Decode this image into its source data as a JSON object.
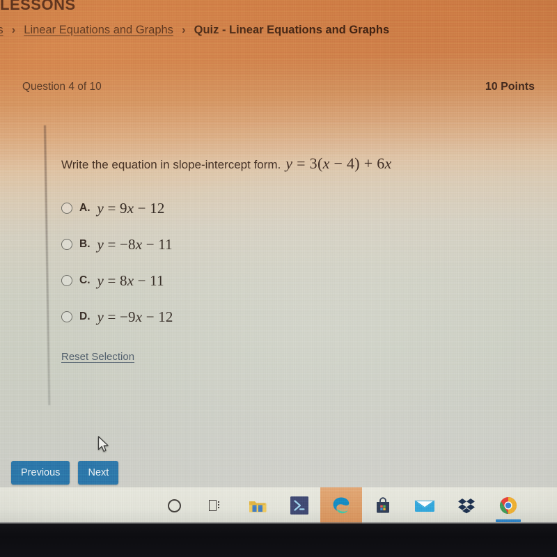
{
  "header": {
    "section_label": "LESSONS",
    "breadcrumb": [
      {
        "label": "ons",
        "type": "link"
      },
      {
        "label": "›",
        "type": "separator"
      },
      {
        "label": "Linear Equations and Graphs",
        "type": "link"
      },
      {
        "label": "›",
        "type": "separator"
      },
      {
        "label": "Quiz - Linear Equations and Graphs",
        "type": "current"
      }
    ]
  },
  "quiz": {
    "question_counter": "Question 4 of 10",
    "points": "10 Points",
    "prompt_text": "Write the equation in slope-intercept form.",
    "prompt_equation": "y = 3(x − 4) + 6x",
    "choices": [
      {
        "letter": "A.",
        "equation": "y = 9x − 12",
        "selected": false
      },
      {
        "letter": "B.",
        "equation": "y = −8x − 11",
        "selected": false
      },
      {
        "letter": "C.",
        "equation": "y = 8x − 11",
        "selected": false
      },
      {
        "letter": "D.",
        "equation": "y = −9x − 12",
        "selected": false
      }
    ],
    "reset_label": "Reset Selection",
    "previous_label": "Previous",
    "next_label": "Next"
  },
  "taskbar": {
    "items": [
      {
        "name": "cortana-icon",
        "label": "Cortana"
      },
      {
        "name": "task-view-icon",
        "label": "Task View"
      },
      {
        "name": "file-explorer-icon",
        "label": "File Explorer"
      },
      {
        "name": "powershell-icon",
        "label": "Windows PowerShell"
      },
      {
        "name": "edge-icon",
        "label": "Microsoft Edge"
      },
      {
        "name": "microsoft-store-icon",
        "label": "Microsoft Store"
      },
      {
        "name": "mail-icon",
        "label": "Mail"
      },
      {
        "name": "dropbox-icon",
        "label": "Dropbox"
      },
      {
        "name": "chrome-icon",
        "label": "Google Chrome"
      }
    ]
  },
  "colors": {
    "header_orange": "#cf7b41",
    "button_blue": "#2b78ab",
    "link_blue": "#4c5a68",
    "taskbar_highlight": "#e29656",
    "active_indicator": "#2f86c8"
  }
}
